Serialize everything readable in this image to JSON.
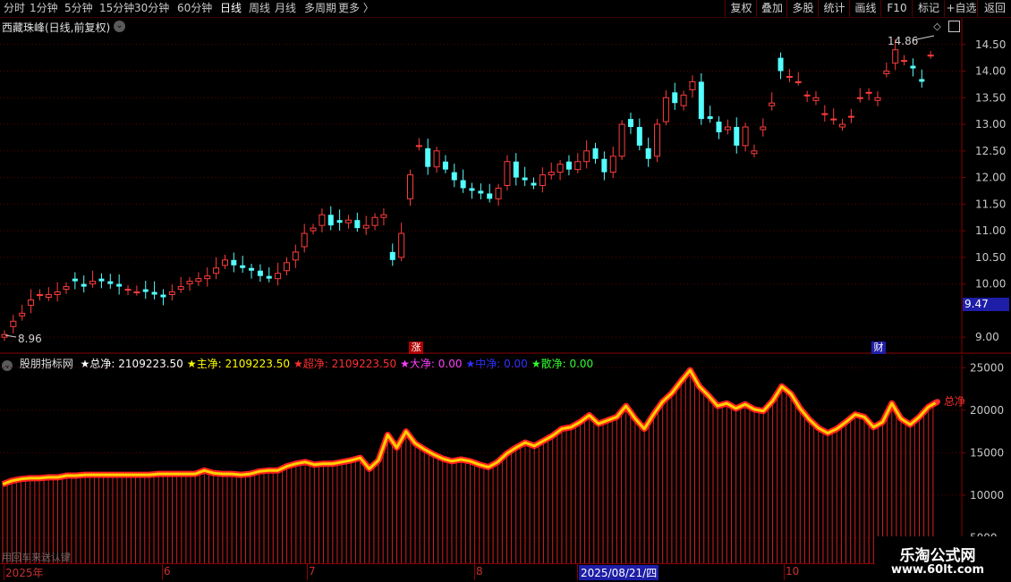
{
  "toolbar": {
    "periods": [
      "分时",
      "1分钟",
      "5分钟",
      "15分钟",
      "30分钟",
      "60分钟",
      "日线",
      "周线",
      "月线",
      "多周期",
      "更多"
    ],
    "active_period": "日线",
    "right_buttons": [
      "复权",
      "叠加",
      "多股",
      "统计",
      "画线",
      "F10",
      "标记",
      "+自选",
      "返回"
    ]
  },
  "main": {
    "title": "西藏珠峰(日线,前复权)",
    "high_label": "14.86",
    "low_label": "8.96",
    "last_price": "9.47",
    "badge_zhang": "涨",
    "badge_cai": "财",
    "y_ticks": [
      "14.50",
      "14.00",
      "13.50",
      "13.00",
      "12.50",
      "12.00",
      "11.50",
      "11.00",
      "10.50",
      "10.00",
      "9.00"
    ]
  },
  "indicator": {
    "name": "股朋指标网",
    "items": [
      {
        "label": "★总净: 2109223.50",
        "color": "#ffffff"
      },
      {
        "label": "★主净: 2109223.50",
        "color": "#ffff00"
      },
      {
        "label": "★超净: 2109223.50",
        "color": "#ff3030"
      },
      {
        "label": "★大净: 0.00",
        "color": "#ff40ff"
      },
      {
        "label": "★中净: 0.00",
        "color": "#3030ff"
      },
      {
        "label": "★散净: 0.00",
        "color": "#30ff30"
      }
    ],
    "y_ticks": [
      "25000",
      "20000",
      "15000",
      "10000",
      "5000"
    ],
    "end_label": "总净",
    "footer_text": "用回车来送认键"
  },
  "dates": {
    "labels": [
      "2025年",
      "6",
      "7",
      "8",
      "2025/08/21/四",
      "10"
    ]
  },
  "watermark": {
    "line1": "乐淘公式网",
    "line2": "www.60lt.com"
  },
  "chart_data": [
    {
      "type": "candlestick",
      "title": "西藏珠峰(日线,前复权)",
      "ylim": [
        8.7,
        15.0
      ],
      "y_ticks": [
        9.0,
        10.0,
        10.5,
        11.0,
        11.5,
        12.0,
        12.5,
        13.0,
        13.5,
        14.0,
        14.5
      ],
      "high_marker": 14.86,
      "low_marker": 8.96,
      "close": [
        9.05,
        9.3,
        9.45,
        9.7,
        9.8,
        9.8,
        9.85,
        9.95,
        10.05,
        9.95,
        10.05,
        10.05,
        10.0,
        9.95,
        9.9,
        9.85,
        9.85,
        9.8,
        9.75,
        9.85,
        9.95,
        10.05,
        10.1,
        10.15,
        10.3,
        10.45,
        10.35,
        10.3,
        10.25,
        10.15,
        10.1,
        10.2,
        10.4,
        10.6,
        10.95,
        11.05,
        11.3,
        11.1,
        11.15,
        11.2,
        11.05,
        11.1,
        11.25,
        11.3,
        10.45,
        10.95,
        12.05,
        12.6,
        12.2,
        12.5,
        12.15,
        11.95,
        11.8,
        11.75,
        11.7,
        11.6,
        11.8,
        12.3,
        12.0,
        11.95,
        11.85,
        12.05,
        12.1,
        12.25,
        12.15,
        12.3,
        12.5,
        12.35,
        12.1,
        12.4,
        13.0,
        12.95,
        12.6,
        12.35,
        13.0,
        13.5,
        13.4,
        13.55,
        13.8,
        13.1,
        13.1,
        12.85,
        12.95,
        12.6,
        12.95,
        12.5,
        12.95,
        13.4,
        14.0,
        13.9,
        13.8,
        13.55,
        13.5,
        13.2,
        13.1,
        13.0,
        13.15,
        13.5,
        13.6,
        13.5,
        14.0,
        14.4,
        14.2,
        14.05,
        13.8,
        14.3,
        14.6
      ],
      "open": [
        9.0,
        9.2,
        9.4,
        9.6,
        9.8,
        9.75,
        9.8,
        9.9,
        10.1,
        10.0,
        10.0,
        10.1,
        10.05,
        10.0,
        9.9,
        9.85,
        9.9,
        9.85,
        9.8,
        9.8,
        9.9,
        10.0,
        10.05,
        10.1,
        10.2,
        10.35,
        10.45,
        10.35,
        10.3,
        10.25,
        10.15,
        10.1,
        10.25,
        10.45,
        10.7,
        11.0,
        11.1,
        11.3,
        11.2,
        11.15,
        11.2,
        11.05,
        11.1,
        11.25,
        10.6,
        10.5,
        11.6,
        12.6,
        12.55,
        12.2,
        12.3,
        12.1,
        11.95,
        11.8,
        11.75,
        11.7,
        11.6,
        11.85,
        12.3,
        12.0,
        11.9,
        11.85,
        12.05,
        12.1,
        12.3,
        12.15,
        12.3,
        12.55,
        12.35,
        12.1,
        12.4,
        13.1,
        12.95,
        12.55,
        12.4,
        13.05,
        13.6,
        13.35,
        13.65,
        13.8,
        13.15,
        13.05,
        12.9,
        12.95,
        12.6,
        12.45,
        12.9,
        13.35,
        14.25,
        13.9,
        13.8,
        13.55,
        13.45,
        13.2,
        13.1,
        12.95,
        13.15,
        13.5,
        13.6,
        13.45,
        13.95,
        14.15,
        14.2,
        14.1,
        13.85,
        14.3
      ]
    },
    {
      "type": "line",
      "series_name": "总净",
      "ylim": [
        2000,
        26500
      ],
      "y_ticks": [
        5000,
        10000,
        15000,
        20000,
        25000
      ],
      "values": [
        11300,
        11700,
        11900,
        12000,
        12000,
        12100,
        12100,
        12300,
        12300,
        12400,
        12400,
        12400,
        12400,
        12400,
        12400,
        12400,
        12400,
        12500,
        12500,
        12500,
        12500,
        12500,
        12900,
        12600,
        12500,
        12500,
        12400,
        12500,
        12800,
        12900,
        12900,
        13400,
        13700,
        13900,
        13600,
        13700,
        13700,
        13900,
        14100,
        14400,
        13100,
        14100,
        17100,
        15600,
        17500,
        16100,
        15400,
        14800,
        14300,
        14000,
        14200,
        14000,
        13600,
        13300,
        13900,
        14900,
        15600,
        16200,
        15800,
        16400,
        17000,
        17800,
        18000,
        18600,
        19400,
        18400,
        18800,
        19200,
        20500,
        19000,
        17800,
        19500,
        21000,
        22000,
        23400,
        24700,
        22800,
        21700,
        20500,
        20800,
        20200,
        20700,
        20100,
        19900,
        21100,
        22800,
        21900,
        20200,
        18900,
        17900,
        17300,
        17800,
        18600,
        19500,
        19200,
        18000,
        18600,
        20800,
        19000,
        18300,
        19200,
        20400,
        21000
      ]
    }
  ]
}
